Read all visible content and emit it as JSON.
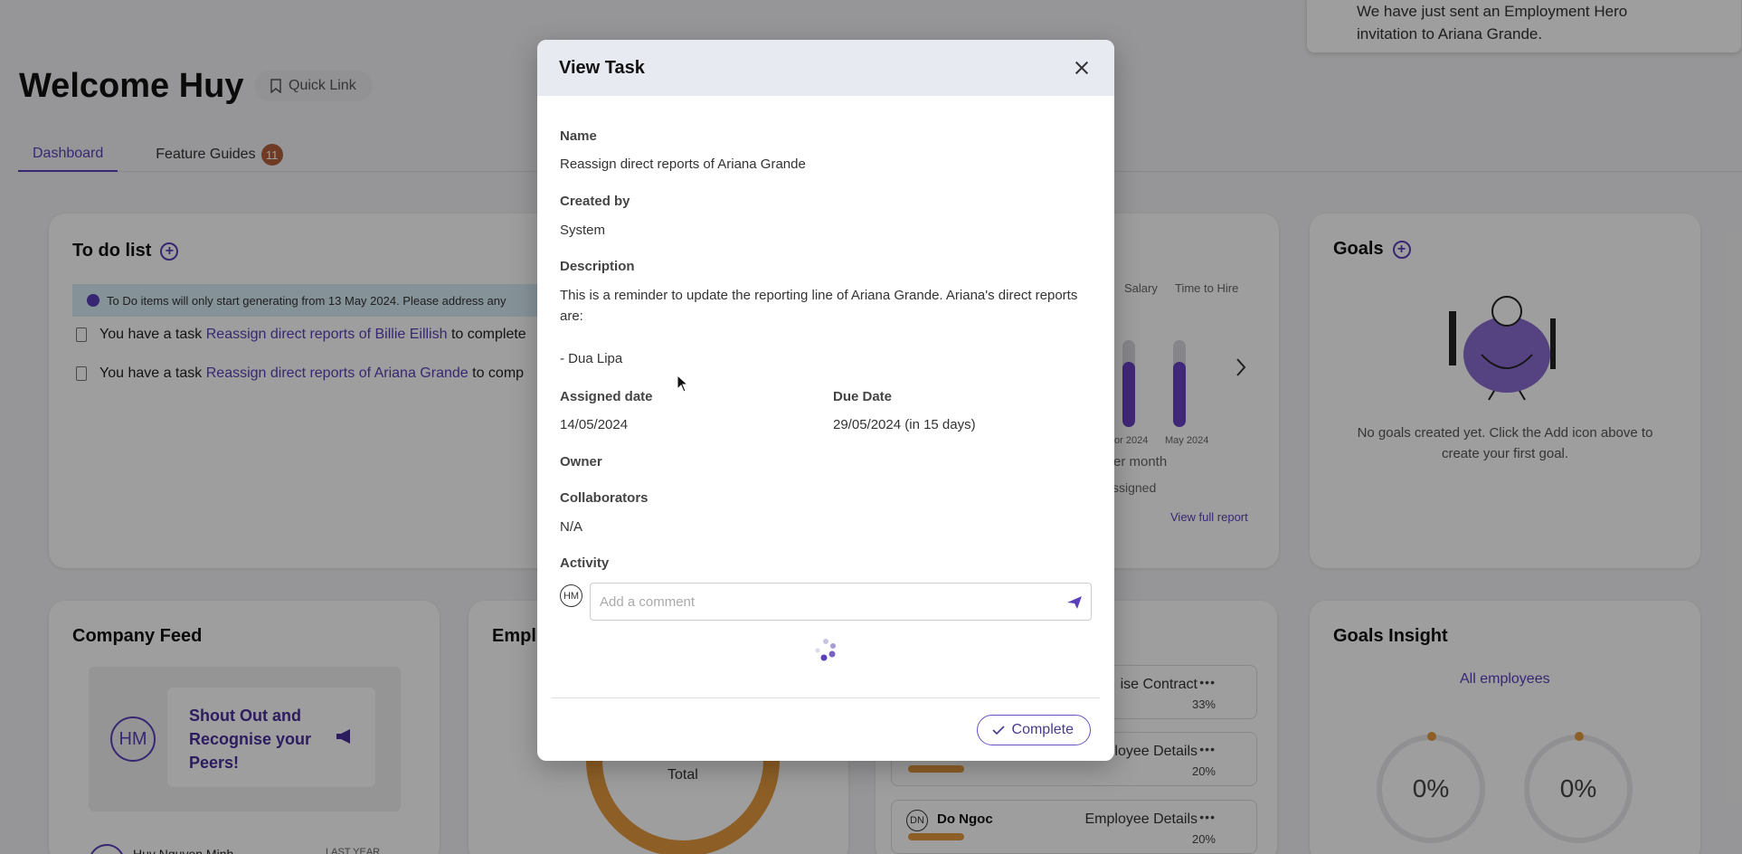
{
  "toast": {
    "text": "We have just sent an Employment Hero invitation to Ariana Grande."
  },
  "header": {
    "welcome": "Welcome Huy",
    "quick_link": "Quick Link",
    "tabs": [
      {
        "label": "Dashboard"
      },
      {
        "label": "Feature Guides",
        "badge": "11"
      }
    ]
  },
  "todo": {
    "title": "To do list",
    "banner": "To Do items will only start generating from 13 May 2024. Please address any",
    "items": [
      {
        "prefix": "You have a task",
        "link": "Reassign direct reports of Billie Eillish",
        "suffix": "to complete"
      },
      {
        "prefix": "You have a task",
        "link": "Reassign direct reports of Ariana Grande",
        "suffix": "to comp"
      }
    ]
  },
  "report_card": {
    "col_salary": "Salary",
    "col_time_to_hire": "Time to Hire",
    "tick_1": "or 2024",
    "tick_2": "May 2024",
    "axis_label": "er month",
    "legend": "ssigned",
    "view_full_report": "View full report"
  },
  "goals": {
    "title": "Goals",
    "empty_text": "No goals created yet. Click the Add icon above to create your first goal."
  },
  "company_feed": {
    "title": "Company Feed",
    "avatar": "HM",
    "shout_out": "Shout Out and Recognise your Peers!",
    "post_author": "Huy Nguyen Minh",
    "post_time": "LAST YEAR"
  },
  "employee_card": {
    "title": "Empl",
    "total_label": "Total"
  },
  "progress": {
    "rows": [
      {
        "label": "ise Contract",
        "pct": "33%"
      },
      {
        "label": "ployee Details",
        "pct": "20%"
      },
      {
        "name": "Do Ngoc",
        "avatar": "DN",
        "label": "Employee Details",
        "pct": "20%"
      }
    ]
  },
  "goals_insight": {
    "title": "Goals Insight",
    "link": "All employees",
    "ring_1": "0%",
    "ring_2": "0%"
  },
  "modal": {
    "title": "View Task",
    "name_label": "Name",
    "name_value": "Reassign direct reports of Ariana Grande",
    "created_by_label": "Created by",
    "created_by_value": "System",
    "description_label": "Description",
    "description_value": "This is a reminder to update the reporting line of Ariana Grande. Ariana's direct reports are:",
    "description_list": "- Dua Lipa",
    "assigned_date_label": "Assigned date",
    "assigned_date_value": "14/05/2024",
    "due_date_label": "Due Date",
    "due_date_value": "29/05/2024 (in 15 days)",
    "owner_label": "Owner",
    "collaborators_label": "Collaborators",
    "collaborators_value": "N/A",
    "activity_label": "Activity",
    "comment_avatar": "HM",
    "comment_placeholder": "Add a comment",
    "complete_button": "Complete"
  },
  "colors": {
    "accent": "#5a3fb8",
    "orange": "#e49a3e",
    "overlay": "rgba(0,0,0,0.38)"
  }
}
